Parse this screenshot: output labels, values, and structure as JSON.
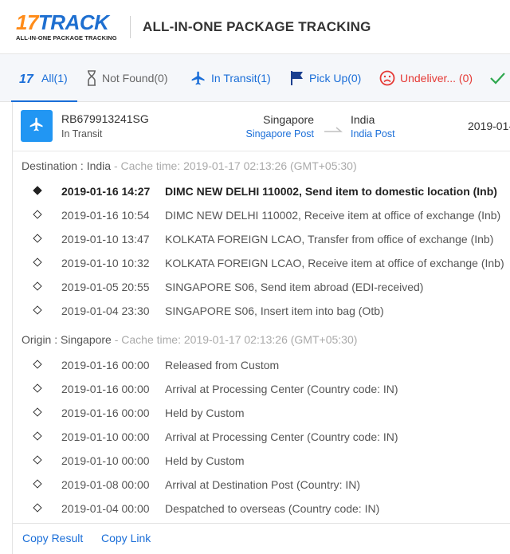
{
  "header": {
    "logo_number": "17",
    "logo_word": "TRACK",
    "logo_tagline": "ALL-IN-ONE PACKAGE TRACKING",
    "title": "ALL-IN-ONE PACKAGE TRACKING"
  },
  "tabs": {
    "all": "All(1)",
    "not_found": "Not Found(0)",
    "in_transit": "In Transit(1)",
    "pick_up": "Pick Up(0)",
    "undelivered": "Undeliver... (0)"
  },
  "colors": {
    "accent": "#1a6ed8",
    "logo_orange": "#ff8c1a",
    "transit_badge": "#2196f3",
    "undelivered": "#e53935",
    "delivered": "#2fa84f"
  },
  "shipment": {
    "tracking_number": "RB679913241SG",
    "status": "In Transit",
    "origin_country": "Singapore",
    "origin_carrier": "Singapore Post",
    "destination_country": "India",
    "destination_carrier": "India Post",
    "date": "2019-01-"
  },
  "destination_section": {
    "label": "Destination : India",
    "cache": " - Cache time: 2019-01-17 02:13:26 (GMT+05:30)",
    "events": [
      {
        "time": "2019-01-16 14:27",
        "desc": "DIMC NEW DELHI 110002, Send item to domestic location (Inb)"
      },
      {
        "time": "2019-01-16 10:54",
        "desc": "DIMC NEW DELHI 110002, Receive item at office of exchange (Inb)"
      },
      {
        "time": "2019-01-10 13:47",
        "desc": "KOLKATA FOREIGN LCAO, Transfer from office of exchange (Inb)"
      },
      {
        "time": "2019-01-10 10:32",
        "desc": "KOLKATA FOREIGN LCAO, Receive item at office of exchange (Inb)"
      },
      {
        "time": "2019-01-05 20:55",
        "desc": "SINGAPORE S06, Send item abroad (EDI-received)"
      },
      {
        "time": "2019-01-04 23:30",
        "desc": "SINGAPORE S06, Insert item into bag (Otb)"
      }
    ]
  },
  "origin_section": {
    "label": "Origin : Singapore",
    "cache": " - Cache time: 2019-01-17 02:13:26 (GMT+05:30)",
    "events": [
      {
        "time": "2019-01-16 00:00",
        "desc": "Released from Custom"
      },
      {
        "time": "2019-01-16 00:00",
        "desc": "Arrival at Processing Center (Country code: IN)"
      },
      {
        "time": "2019-01-16 00:00",
        "desc": "Held by Custom"
      },
      {
        "time": "2019-01-10 00:00",
        "desc": "Arrival at Processing Center (Country code: IN)"
      },
      {
        "time": "2019-01-10 00:00",
        "desc": "Held by Custom"
      },
      {
        "time": "2019-01-08 00:00",
        "desc": "Arrival at Destination Post (Country: IN)"
      },
      {
        "time": "2019-01-04 00:00",
        "desc": "Despatched to overseas (Country code: IN)"
      }
    ]
  },
  "actions": {
    "copy_result": "Copy Result",
    "copy_link": "Copy Link"
  }
}
